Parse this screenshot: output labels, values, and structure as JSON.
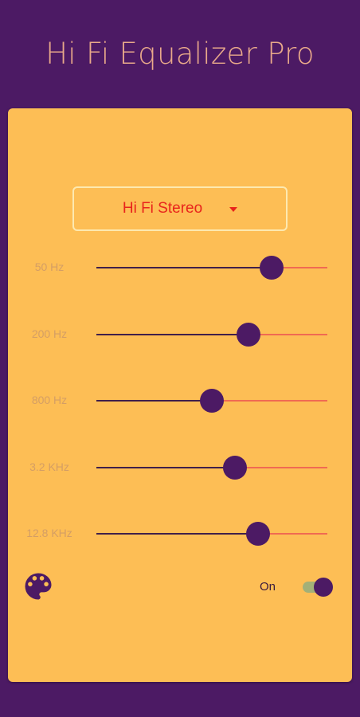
{
  "app": {
    "title": "Hi Fi Equalizer Pro"
  },
  "preset": {
    "selected": "Hi Fi Stereo"
  },
  "bands": [
    {
      "label": "50 Hz",
      "level": 0.76
    },
    {
      "label": "200 Hz",
      "level": 0.66
    },
    {
      "label": "800 Hz",
      "level": 0.5
    },
    {
      "label": "3.2 KHz",
      "level": 0.6
    },
    {
      "label": "12.8 KHz",
      "level": 0.7
    }
  ],
  "power": {
    "label": "On",
    "enabled": true
  },
  "icons": {
    "palette": "palette-icon"
  },
  "colors": {
    "background": "#4c1a64",
    "card": "#fdbe55",
    "accent": "#e8241c",
    "thumb": "#4c1a64"
  }
}
